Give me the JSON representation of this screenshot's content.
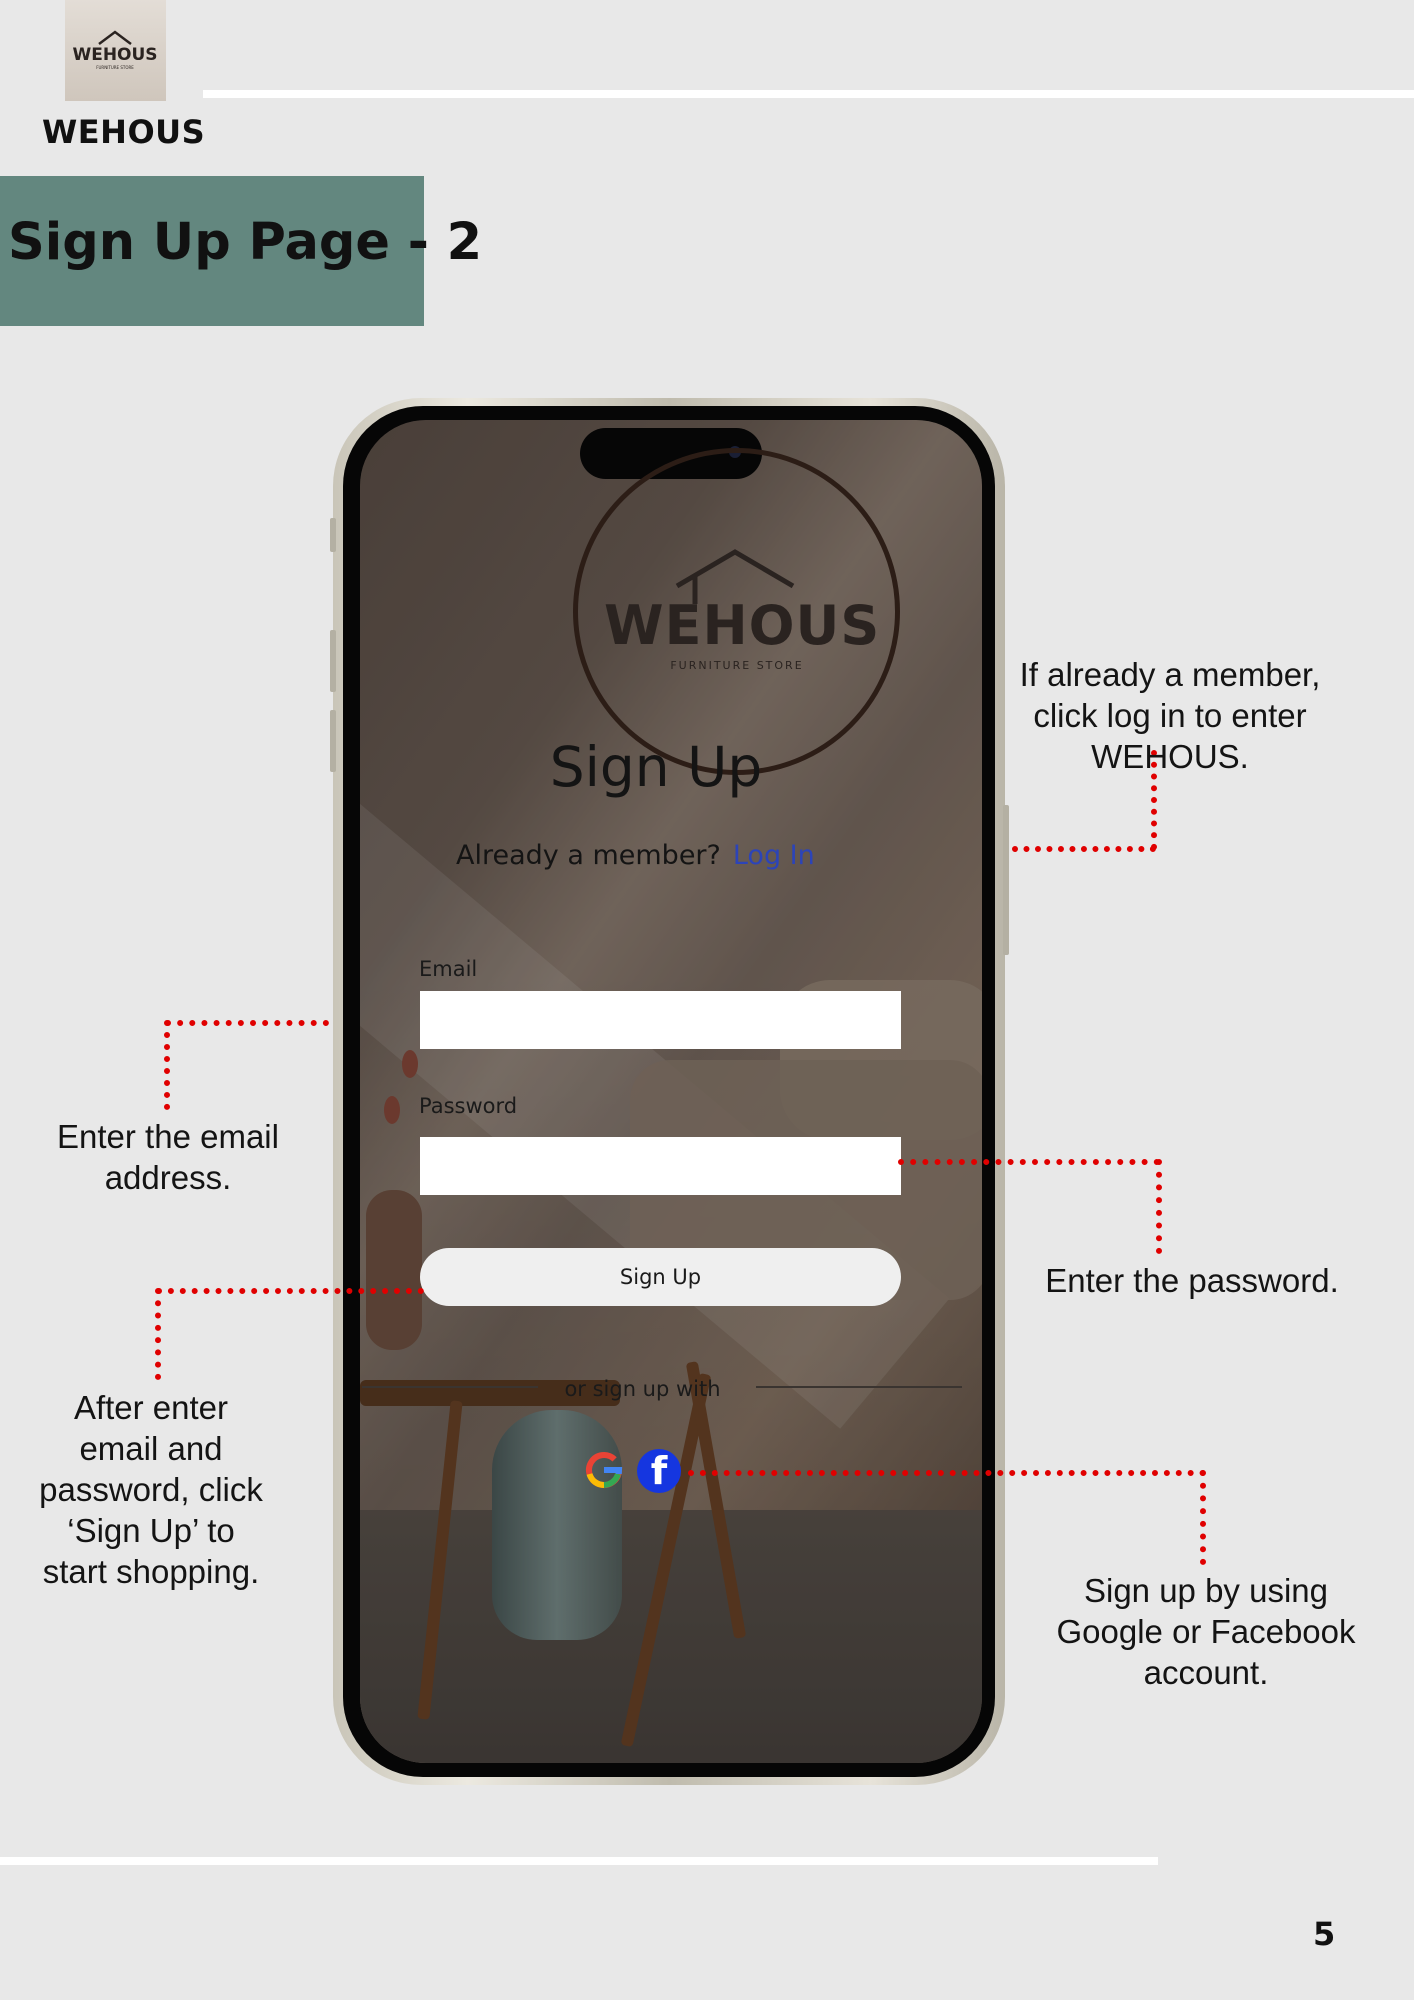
{
  "document": {
    "brand_name": "WEHOUS",
    "page_title": "Sign Up Page - 2",
    "page_number": "5",
    "logo_thumbnail_alt": "WEHOUS Furniture Store logo"
  },
  "app": {
    "logo": {
      "wordmark": "WEHOUS",
      "tagline": "FURNITURE STORE"
    },
    "heading": "Sign Up",
    "member_prompt": "Already a member?",
    "login_link": "Log In",
    "email_label": "Email",
    "email_value": "",
    "password_label": "Password",
    "password_value": "",
    "signup_button": "Sign Up",
    "alt_signup_text": "or sign up with",
    "social_icons": [
      "google-icon",
      "facebook-icon"
    ]
  },
  "annotations": {
    "login_note": [
      "If already a member,",
      "click log in to enter",
      "WEHOUS."
    ],
    "email_note": [
      "Enter the email",
      "address."
    ],
    "password_note": [
      "Enter the password."
    ],
    "signup_note": [
      "After enter",
      "email and",
      "password, click",
      "‘Sign Up’ to",
      "start shopping."
    ],
    "social_note": [
      "Sign up by using",
      "Google or Facebook",
      "account."
    ]
  },
  "colors": {
    "page_background": "#e8e8e8",
    "title_band": "#63877f",
    "callout_line": "#e00000",
    "login_link": "#2c44b8",
    "facebook_blue": "#1536e0"
  }
}
